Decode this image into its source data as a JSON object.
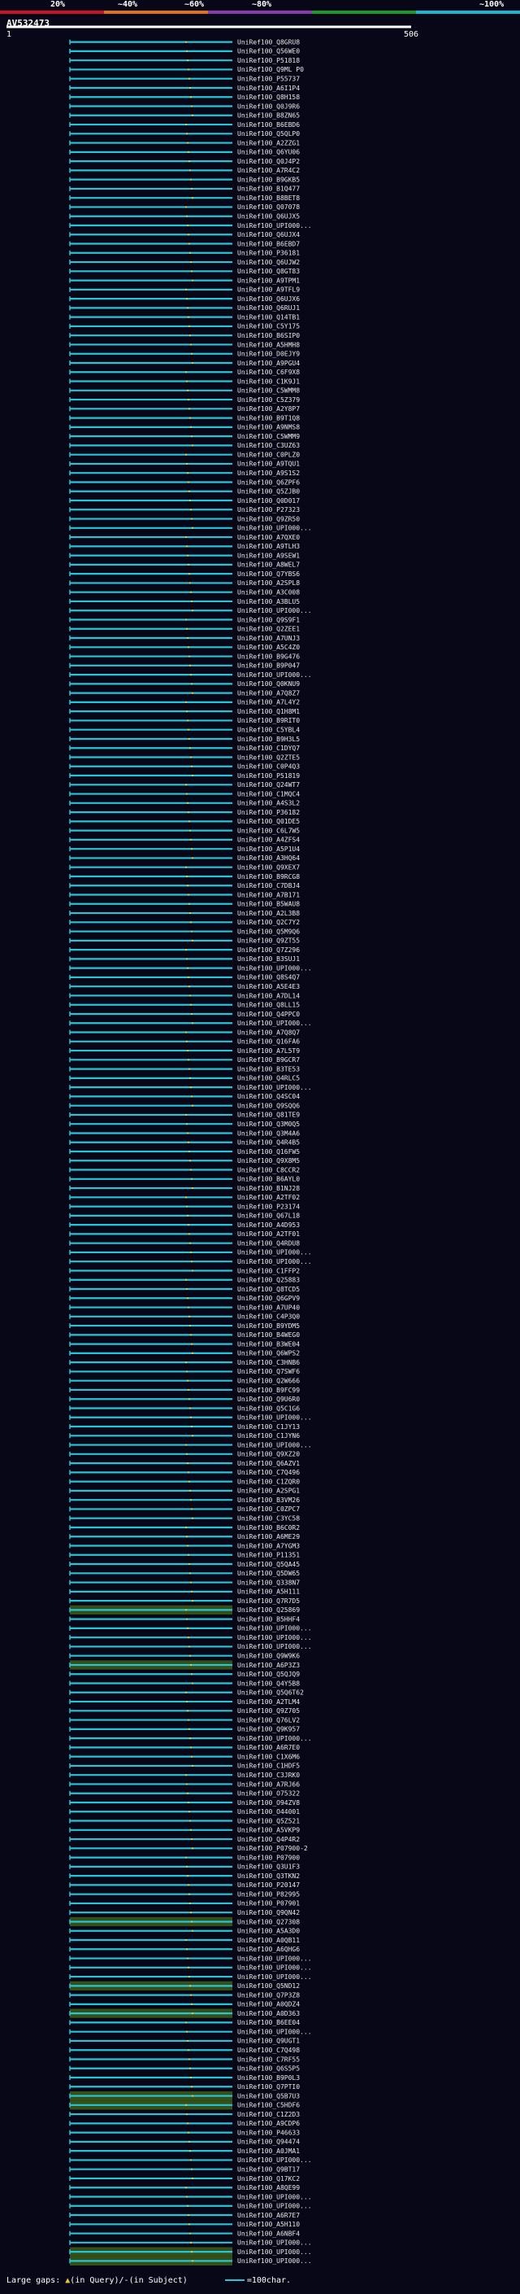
{
  "colors": {
    "background": "#070717",
    "hit_bar": "#26c6d8",
    "highlight_row": "#5a8a18",
    "gap_marker": "#f0c040",
    "scale_segments": [
      "#d0102a",
      "#e0701a",
      "#8a3ab0",
      "#1a9a2a",
      "#1ab8d0"
    ]
  },
  "scale": {
    "ticks": [
      "20%",
      "~40%",
      "~60%",
      "~80%",
      "~100%"
    ]
  },
  "query": {
    "name": "AV532473",
    "start_label": "1",
    "end_label": "506"
  },
  "legend": {
    "gaps_label": "Large gaps:",
    "gaps_query_glyph": "▲",
    "gaps_query_text": "(in Query)/",
    "gaps_subject_glyph": "-",
    "gaps_subject_text": "(in Subject)",
    "bar_text": "=100char."
  },
  "chart_data": {
    "type": "alignment",
    "query_length": 506,
    "highlighted_rows": [
      171,
      177,
      205,
      212,
      215,
      224,
      225,
      241,
      242,
      248,
      255,
      264,
      271,
      273,
      276,
      278,
      283,
      286,
      288,
      291
    ],
    "rows": [
      {
        "label": "UniRef100_Q8GRU8"
      },
      {
        "label": "UniRef100_Q56WE0"
      },
      {
        "label": "UniRef100_P51818"
      },
      {
        "label": "UniRef100_Q9ML P0"
      },
      {
        "label": "UniRef100_P55737"
      },
      {
        "label": "UniRef100_A6I1P4"
      },
      {
        "label": "UniRef100_Q8H158"
      },
      {
        "label": "UniRef100_Q0J9R6"
      },
      {
        "label": "UniRef100_B8ZN65"
      },
      {
        "label": "UniRef100_B6EBD6"
      },
      {
        "label": "UniRef100_Q5QLP0"
      },
      {
        "label": "UniRef100_A2ZZG1"
      },
      {
        "label": "UniRef100_Q6YU06"
      },
      {
        "label": "UniRef100_Q0J4P2"
      },
      {
        "label": "UniRef100_A7R4C2"
      },
      {
        "label": "UniRef100_B9GKB5"
      },
      {
        "label": "UniRef100_B1Q477"
      },
      {
        "label": "UniRef100_B8BET8"
      },
      {
        "label": "UniRef100_Q07078"
      },
      {
        "label": "UniRef100_Q6UJX5"
      },
      {
        "label": "UniRef100_UPI000..."
      },
      {
        "label": "UniRef100_Q6UJX4"
      },
      {
        "label": "UniRef100_B6EBD7"
      },
      {
        "label": "UniRef100_P36181"
      },
      {
        "label": "UniRef100_Q6UJW2"
      },
      {
        "label": "UniRef100_Q8GT83"
      },
      {
        "label": "UniRef100_A9TPM1"
      },
      {
        "label": "UniRef100_A9TFL9"
      },
      {
        "label": "UniRef100_Q6UJX6"
      },
      {
        "label": "UniRef100_Q6RUJ1"
      },
      {
        "label": "UniRef100_Q14TB1"
      },
      {
        "label": "UniRef100_C5Y175"
      },
      {
        "label": "UniRef100_B6SIP0"
      },
      {
        "label": "UniRef100_A5HMH8"
      },
      {
        "label": "UniRef100_D0EJY9"
      },
      {
        "label": "UniRef100_A9PGU4"
      },
      {
        "label": "UniRef100_C6F9X8"
      },
      {
        "label": "UniRef100_C1K9J1"
      },
      {
        "label": "UniRef100_C5WMM8"
      },
      {
        "label": "UniRef100_C5Z379"
      },
      {
        "label": "UniRef100_A2Y8P7"
      },
      {
        "label": "UniRef100_B9T1Q8"
      },
      {
        "label": "UniRef100_A9NMS8"
      },
      {
        "label": "UniRef100_C5WMM9"
      },
      {
        "label": "UniRef100_C3UZ63"
      },
      {
        "label": "UniRef100_C0PLZ0"
      },
      {
        "label": "UniRef100_A9TQU1"
      },
      {
        "label": "UniRef100_A9S1S2"
      },
      {
        "label": "UniRef100_Q6ZPF6"
      },
      {
        "label": "UniRef100_Q5ZJB0"
      },
      {
        "label": "UniRef100_Q0D017"
      },
      {
        "label": "UniRef100_P27323"
      },
      {
        "label": "UniRef100_Q9ZR50"
      },
      {
        "label": "UniRef100_UPI000..."
      },
      {
        "label": "UniRef100_A7QXE0"
      },
      {
        "label": "UniRef100_A9TLH3"
      },
      {
        "label": "UniRef100_A9SEW1"
      },
      {
        "label": "UniRef100_A8WEL7"
      },
      {
        "label": "UniRef100_Q7YBS6"
      },
      {
        "label": "UniRef100_A2SPL8"
      },
      {
        "label": "UniRef100_A3C008"
      },
      {
        "label": "UniRef100_A3BLU5"
      },
      {
        "label": "UniRef100_UPI000..."
      },
      {
        "label": "UniRef100_Q9S9F1"
      },
      {
        "label": "UniRef100_Q2ZEE1"
      },
      {
        "label": "UniRef100_A7UNJ3"
      },
      {
        "label": "UniRef100_A5C4Z0"
      },
      {
        "label": "UniRef100_B9G476"
      },
      {
        "label": "UniRef100_B9P047"
      },
      {
        "label": "UniRef100_UPI000..."
      },
      {
        "label": "UniRef100_Q0KNU9"
      },
      {
        "label": "UniRef100_A7Q8Z7"
      },
      {
        "label": "UniRef100_A7L4Y2"
      },
      {
        "label": "UniRef100_Q1H8M1"
      },
      {
        "label": "UniRef100_B9RIT0"
      },
      {
        "label": "UniRef100_C5YBL4"
      },
      {
        "label": "UniRef100_B9H3L5"
      },
      {
        "label": "UniRef100_C1DYQ7"
      },
      {
        "label": "UniRef100_Q2ZTE5"
      },
      {
        "label": "UniRef100_C0P4Q3"
      },
      {
        "label": "UniRef100_P51819"
      },
      {
        "label": "UniRef100_Q24WT7"
      },
      {
        "label": "UniRef100_C1MQC4"
      },
      {
        "label": "UniRef100_A4S3L2"
      },
      {
        "label": "UniRef100_P36182"
      },
      {
        "label": "UniRef100_Q01DE5"
      },
      {
        "label": "UniRef100_C6L7W5"
      },
      {
        "label": "UniRef100_A4ZFS4"
      },
      {
        "label": "UniRef100_A5P1U4"
      },
      {
        "label": "UniRef100_A3HQ64"
      },
      {
        "label": "UniRef100_Q9XEX7"
      },
      {
        "label": "UniRef100_B9RCG8"
      },
      {
        "label": "UniRef100_C7DBJ4"
      },
      {
        "label": "UniRef100_A7B171"
      },
      {
        "label": "UniRef100_B5WAU8"
      },
      {
        "label": "UniRef100_A2L3B8"
      },
      {
        "label": "UniRef100_Q2C7Y2"
      },
      {
        "label": "UniRef100_Q5M9Q6"
      },
      {
        "label": "UniRef100_Q9ZT55"
      },
      {
        "label": "UniRef100_Q7Z296"
      },
      {
        "label": "UniRef100_B3SUJ1"
      },
      {
        "label": "UniRef100_UPI000..."
      },
      {
        "label": "UniRef100_Q8S4Q7"
      },
      {
        "label": "UniRef100_A5E4E3"
      },
      {
        "label": "UniRef100_A7DL14"
      },
      {
        "label": "UniRef100_Q8LL15"
      },
      {
        "label": "UniRef100_Q4PPC0"
      },
      {
        "label": "UniRef100_UPI000..."
      },
      {
        "label": "UniRef100_A7Q8Q7"
      },
      {
        "label": "UniRef100_Q16FA6"
      },
      {
        "label": "UniRef100_A7L5T9"
      },
      {
        "label": "UniRef100_B9GCR7"
      },
      {
        "label": "UniRef100_B3TE53"
      },
      {
        "label": "UniRef100_Q4RLC5"
      },
      {
        "label": "UniRef100_UPI000..."
      },
      {
        "label": "UniRef100_Q4SC04"
      },
      {
        "label": "UniRef100_Q9SQQ6"
      },
      {
        "label": "UniRef100_Q81TE9"
      },
      {
        "label": "UniRef100_Q3M0Q5"
      },
      {
        "label": "UniRef100_Q3M4A6"
      },
      {
        "label": "UniRef100_Q4R4B5"
      },
      {
        "label": "UniRef100_Q16FW5"
      },
      {
        "label": "UniRef100_Q9X8M5"
      },
      {
        "label": "UniRef100_C8CCR2"
      },
      {
        "label": "UniRef100_B6AYL0"
      },
      {
        "label": "UniRef100_B1NJ28"
      },
      {
        "label": "UniRef100_A2TF02"
      },
      {
        "label": "UniRef100_P23174"
      },
      {
        "label": "UniRef100_Q67L18"
      },
      {
        "label": "UniRef100_A4D953"
      },
      {
        "label": "UniRef100_A2TF01"
      },
      {
        "label": "UniRef100_Q4RDU8"
      },
      {
        "label": "UniRef100_UPI000..."
      },
      {
        "label": "UniRef100_UPI000..."
      },
      {
        "label": "UniRef100_C1FFP2"
      },
      {
        "label": "UniRef100_Q25883"
      },
      {
        "label": "UniRef100_Q8TCD5"
      },
      {
        "label": "UniRef100_Q6GPV9"
      },
      {
        "label": "UniRef100_A7UP40"
      },
      {
        "label": "UniRef100_C4P3Q0"
      },
      {
        "label": "UniRef100_B9YDM5"
      },
      {
        "label": "UniRef100_B4WEG0"
      },
      {
        "label": "UniRef100_B3WE04"
      },
      {
        "label": "UniRef100_Q6WPS2"
      },
      {
        "label": "UniRef100_C3HNB6"
      },
      {
        "label": "UniRef100_Q7SWF6"
      },
      {
        "label": "UniRef100_Q2W666"
      },
      {
        "label": "UniRef100_B9FC99"
      },
      {
        "label": "UniRef100_Q9U6R0"
      },
      {
        "label": "UniRef100_Q5C1G6"
      },
      {
        "label": "UniRef100_UPI000..."
      },
      {
        "label": "UniRef100_C1JY13"
      },
      {
        "label": "UniRef100_C1JYN6"
      },
      {
        "label": "UniRef100_UPI000..."
      },
      {
        "label": "UniRef100_Q9XZ20"
      },
      {
        "label": "UniRef100_Q6AZV1"
      },
      {
        "label": "UniRef100_C7Q496"
      },
      {
        "label": "UniRef100_C1ZQR0"
      },
      {
        "label": "UniRef100_A2SPG1"
      },
      {
        "label": "UniRef100_B3VM26"
      },
      {
        "label": "UniRef100_C0ZPC7"
      },
      {
        "label": "UniRef100_C3YC58"
      },
      {
        "label": "UniRef100_B6C0R2"
      },
      {
        "label": "UniRef100_A6ME29"
      },
      {
        "label": "UniRef100_A7YGM3"
      },
      {
        "label": "UniRef100_P11351"
      },
      {
        "label": "UniRef100_Q5QA45"
      },
      {
        "label": "UniRef100_Q5DW65"
      },
      {
        "label": "UniRef100_Q338N7"
      },
      {
        "label": "UniRef100_A5H111"
      },
      {
        "label": "UniRef100_Q7R7D5"
      },
      {
        "label": "UniRef100_Q25869"
      },
      {
        "label": "UniRef100_B5HHF4"
      },
      {
        "label": "UniRef100_UPI000..."
      },
      {
        "label": "UniRef100_UPI000..."
      },
      {
        "label": "UniRef100_UPI000..."
      },
      {
        "label": "UniRef100_Q9W9K6"
      },
      {
        "label": "UniRef100_A6P3Z3"
      },
      {
        "label": "UniRef100_Q5QJQ9"
      },
      {
        "label": "UniRef100_Q4Y5B8"
      },
      {
        "label": "UniRef100_Q5Q6T62"
      },
      {
        "label": "UniRef100_A2TLM4"
      },
      {
        "label": "UniRef100_Q9Z705"
      },
      {
        "label": "UniRef100_Q76LV2"
      },
      {
        "label": "UniRef100_Q9K957"
      },
      {
        "label": "UniRef100_UPI000..."
      },
      {
        "label": "UniRef100_A6R7E0"
      },
      {
        "label": "UniRef100_C1X6M6"
      },
      {
        "label": "UniRef100_C1HDF5"
      },
      {
        "label": "UniRef100_C3JRK0"
      },
      {
        "label": "UniRef100_A7RJ66"
      },
      {
        "label": "UniRef100_O75322"
      },
      {
        "label": "UniRef100_O94ZV8"
      },
      {
        "label": "UniRef100_O44001"
      },
      {
        "label": "UniRef100_Q5Z521"
      },
      {
        "label": "UniRef100_A5VKP9"
      },
      {
        "label": "UniRef100_Q4P4R2"
      },
      {
        "label": "UniRef100_P07900-2"
      },
      {
        "label": "UniRef100_P07900"
      },
      {
        "label": "UniRef100_Q3U1F3"
      },
      {
        "label": "UniRef100_Q3TKN2"
      },
      {
        "label": "UniRef100_P20147"
      },
      {
        "label": "UniRef100_P82995"
      },
      {
        "label": "UniRef100_P07901"
      },
      {
        "label": "UniRef100_Q9QN42"
      },
      {
        "label": "UniRef100_Q27308"
      },
      {
        "label": "UniRef100_A5A3D0"
      },
      {
        "label": "UniRef100_A0QB11"
      },
      {
        "label": "UniRef100_A6QHG6"
      },
      {
        "label": "UniRef100_UPI000..."
      },
      {
        "label": "UniRef100_UPI000..."
      },
      {
        "label": "UniRef100_UPI000..."
      },
      {
        "label": "UniRef100_Q5ND12"
      },
      {
        "label": "UniRef100_Q7P3Z8"
      },
      {
        "label": "UniRef100_A0QDZ4"
      },
      {
        "label": "UniRef100_A0D363"
      },
      {
        "label": "UniRef100_B6EE04"
      },
      {
        "label": "UniRef100_UPI000..."
      },
      {
        "label": "UniRef100_Q9UGT1"
      },
      {
        "label": "UniRef100_C7Q498"
      },
      {
        "label": "UniRef100_C7RF55"
      },
      {
        "label": "UniRef100_Q6S5P5"
      },
      {
        "label": "UniRef100_B9P0L3"
      },
      {
        "label": "UniRef100_Q7PTI0"
      },
      {
        "label": "UniRef100_Q5B7U3"
      },
      {
        "label": "UniRef100_C5HDF6"
      },
      {
        "label": "UniRef100_C1Z2D3"
      },
      {
        "label": "UniRef100_A9CDP6"
      },
      {
        "label": "UniRef100_P46633"
      },
      {
        "label": "UniRef100_Q94474"
      },
      {
        "label": "UniRef100_A0JMA1"
      },
      {
        "label": "UniRef100_UPI000..."
      },
      {
        "label": "UniRef100_Q9BT17"
      },
      {
        "label": "UniRef100_Q17KC2"
      },
      {
        "label": "UniRef100_A8QE99"
      },
      {
        "label": "UniRef100_UPI000..."
      },
      {
        "label": "UniRef100_UPI000..."
      },
      {
        "label": "UniRef100_A6R7E7"
      },
      {
        "label": "UniRef100_A5H110"
      },
      {
        "label": "UniRef100_A6NBF4"
      },
      {
        "label": "UniRef100_UPI000..."
      },
      {
        "label": "UniRef100_UPI000..."
      },
      {
        "label": "UniRef100_UPI000..."
      }
    ]
  }
}
